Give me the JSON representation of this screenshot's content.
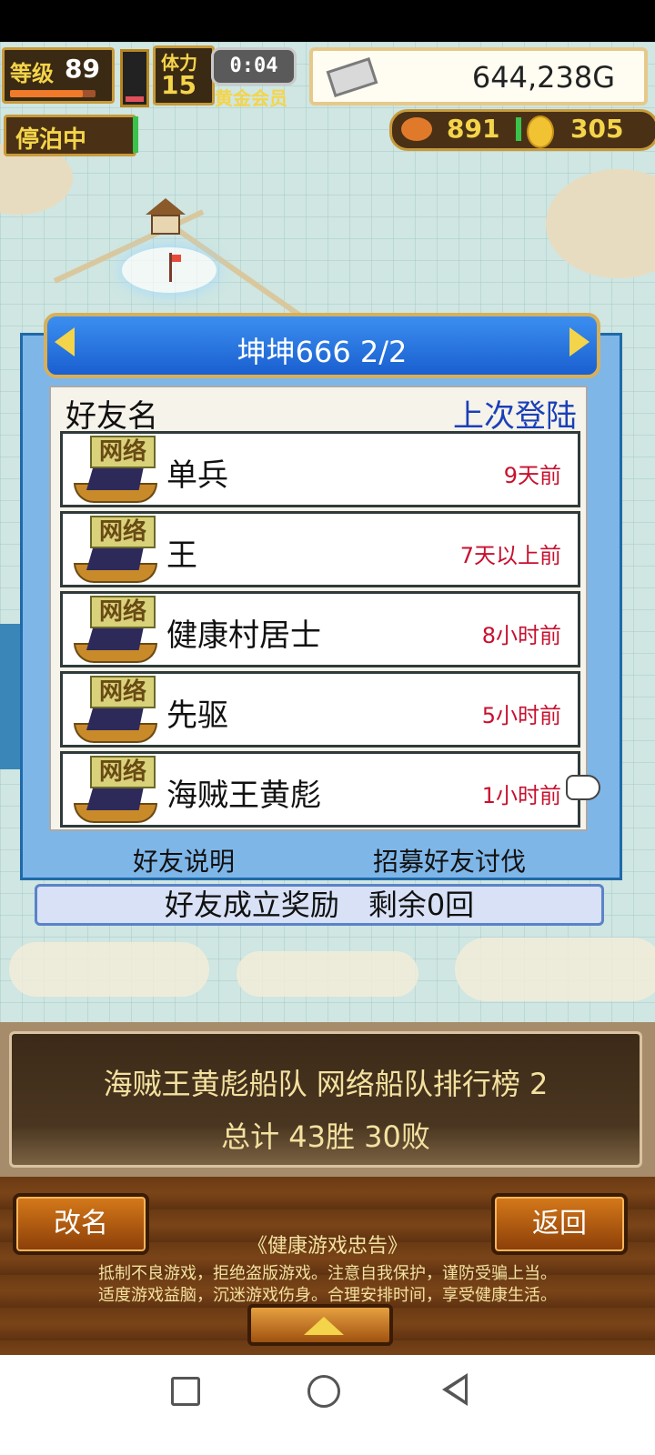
{
  "hud": {
    "level_label": "等级",
    "level_value": "89",
    "level_progress_fraction": 0.85,
    "stamina_fraction": 0.2,
    "physique_label": "体力",
    "physique_value": "15",
    "timer": "0:04",
    "membership": "黄金会员",
    "money": "644,238G",
    "harbor_status": "停泊中",
    "fish_count": "891",
    "coin_count": "305"
  },
  "dialog": {
    "title": "坤坤666 2/2",
    "col_friend_name": "好友名",
    "col_last_login": "上次登陆",
    "ship_badge": "网络",
    "rows": [
      {
        "name": "单兵",
        "last_login": "9天前"
      },
      {
        "name": "王",
        "last_login": "7天以上前"
      },
      {
        "name": "健康村居士",
        "last_login": "8小时前"
      },
      {
        "name": "先驱",
        "last_login": "5小时前"
      },
      {
        "name": "海贼王黄彪",
        "last_login": "1小时前"
      }
    ],
    "link_friend_help": "好友说明",
    "link_recruit": "招募好友讨伐",
    "reward_text": "好友成立奖励　剩余0回"
  },
  "info": {
    "line1": "海贼王黄彪船队  网络船队排行榜  2",
    "line2": "总计 43胜 30败"
  },
  "bottom": {
    "rename_label": "改名",
    "back_label": "返回",
    "notice_title": "《健康游戏忠告》",
    "notice_line1": "抵制不良游戏，拒绝盗版游戏。注意自我保护，谨防受骗上当。",
    "notice_line2": "适度游戏益脑，沉迷游戏伤身。合理安排时间，享受健康生活。"
  },
  "colors": {
    "accent_yellow": "#f4d44a",
    "time_red": "#c8102e",
    "login_blue": "#1a3fb8"
  }
}
